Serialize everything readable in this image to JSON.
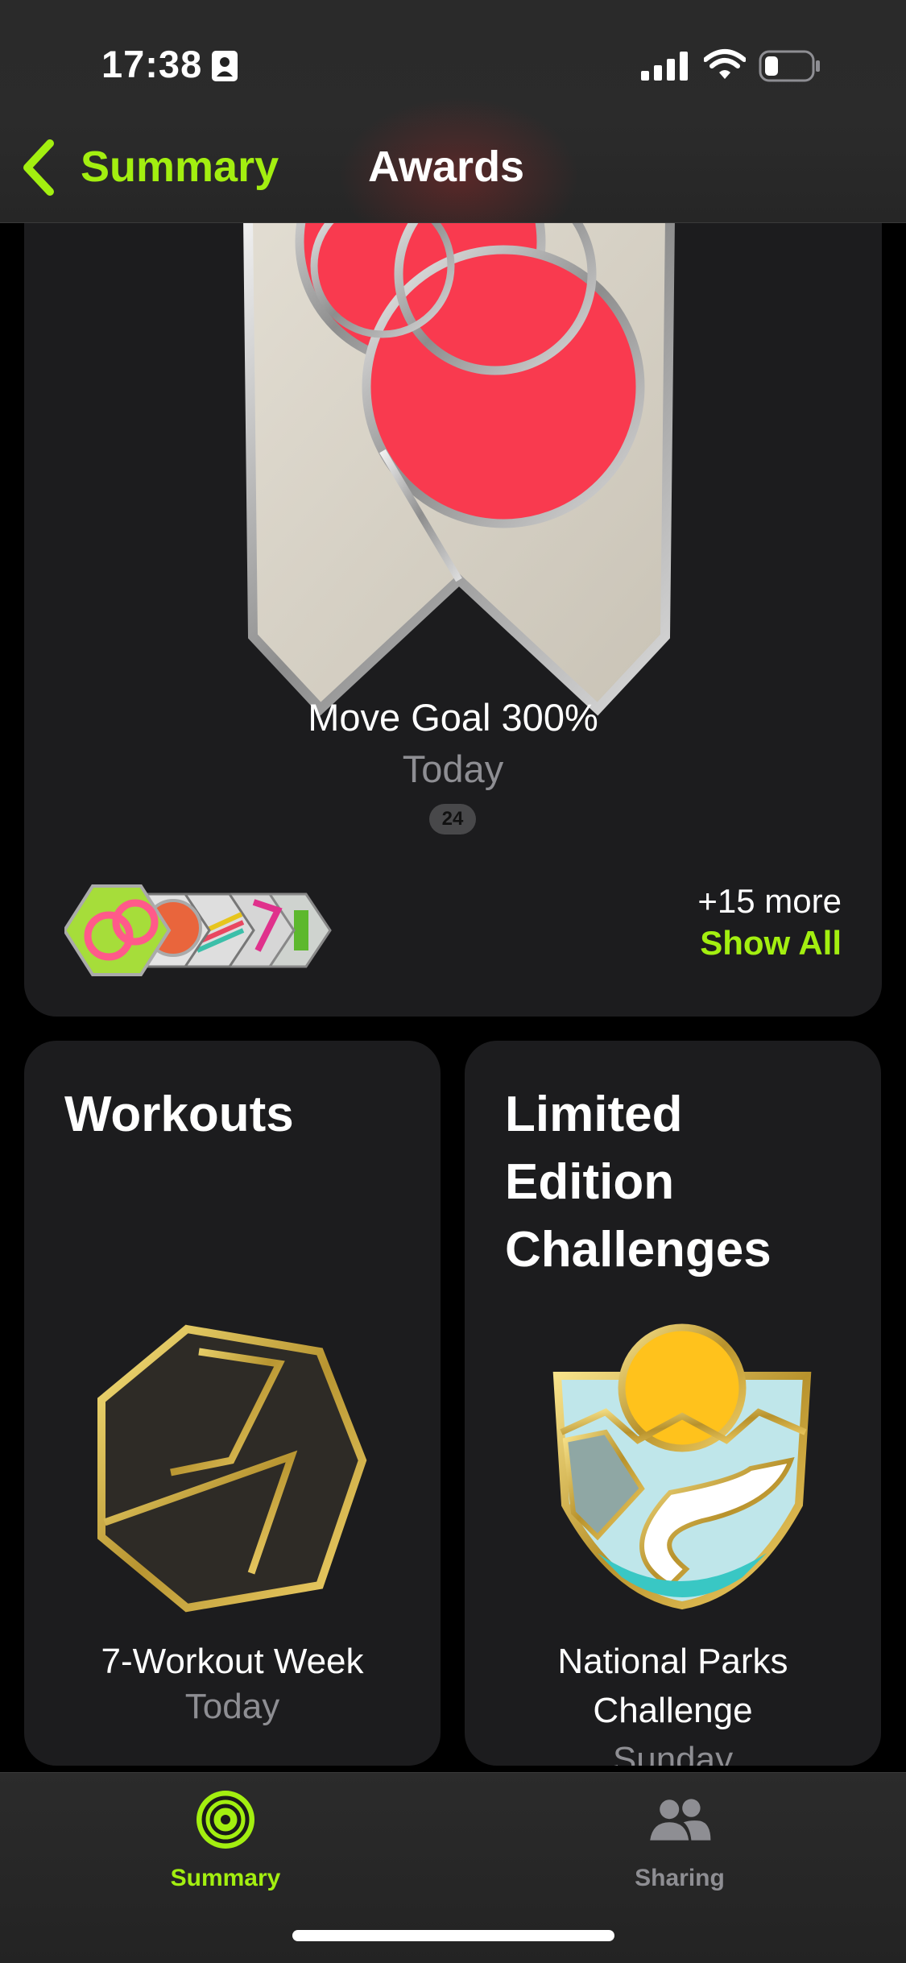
{
  "status_bar": {
    "time": "17:38"
  },
  "nav": {
    "back_label": "Summary",
    "title": "Awards"
  },
  "featured": {
    "title": "Move Goal 300%",
    "date": "Today",
    "count": "24",
    "more_text": "+15 more",
    "show_all_label": "Show All"
  },
  "workouts": {
    "heading": "Workouts",
    "badge_title": "7-Workout Week",
    "badge_date": "Today"
  },
  "limited": {
    "heading_lines": [
      "Limited",
      "Edition",
      "Challenges"
    ],
    "badge_title_lines": [
      "National Parks",
      "Challenge"
    ],
    "badge_date": "Sunday"
  },
  "tabs": [
    {
      "label": "Summary",
      "icon": "activity-rings-icon",
      "selected": true
    },
    {
      "label": "Sharing",
      "icon": "people-icon",
      "selected": false
    }
  ],
  "colors": {
    "accent": "#a3ef10",
    "card_bg": "#1c1c1e",
    "secondary_text": "#8e8e93",
    "move_red": "#f93a4f"
  }
}
